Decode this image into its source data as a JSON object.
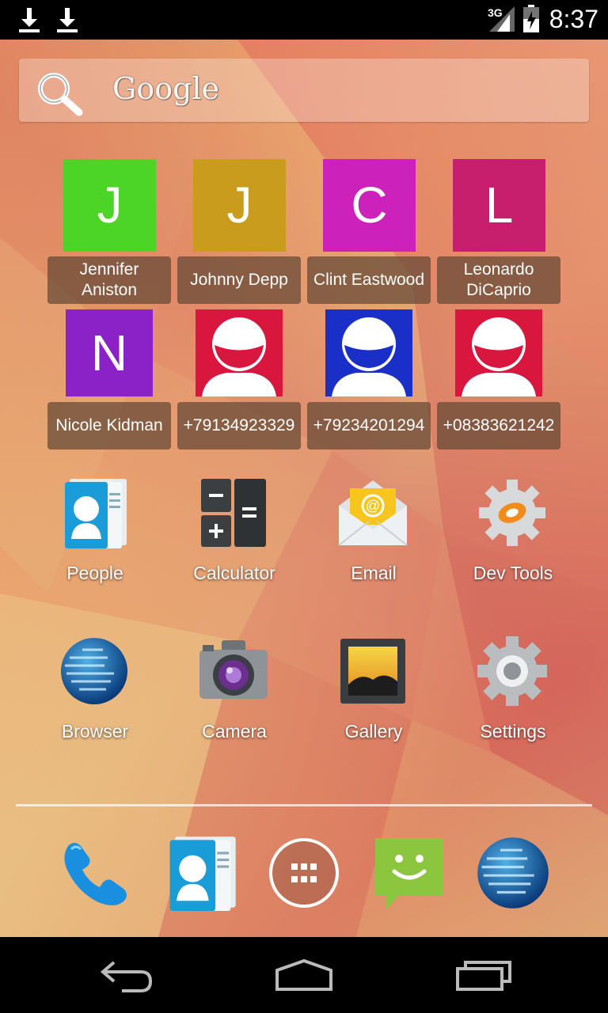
{
  "status_bar": {
    "time": "8:37",
    "network": "3G"
  },
  "search": {
    "label": "Google"
  },
  "contacts": [
    {
      "initial": "J",
      "name_line1": "Jennifer",
      "name_line2": "Aniston",
      "color": "#4cd426"
    },
    {
      "initial": "J",
      "name_line1": "Johnny Depp",
      "name_line2": "",
      "color": "#c99c1e"
    },
    {
      "initial": "C",
      "name_line1": "Clint Eastwood",
      "name_line2": "",
      "color": "#cc22bb"
    },
    {
      "initial": "L",
      "name_line1": "Leonardo",
      "name_line2": "DiCaprio",
      "color": "#c81e6e"
    },
    {
      "initial": "N",
      "name_line1": "Nicole Kidman",
      "name_line2": "",
      "color": "#8a22c8"
    },
    {
      "initial": "",
      "name_line1": "+79134923329",
      "name_line2": "",
      "color": "#d8163e"
    },
    {
      "initial": "",
      "name_line1": "+79234201294",
      "name_line2": "",
      "color": "#1a2ec8"
    },
    {
      "initial": "",
      "name_line1": "+08383621242",
      "name_line2": "",
      "color": "#d8163e"
    }
  ],
  "apps": [
    {
      "label": "People",
      "icon": "people-icon"
    },
    {
      "label": "Calculator",
      "icon": "calculator-icon"
    },
    {
      "label": "Email",
      "icon": "email-icon"
    },
    {
      "label": "Dev Tools",
      "icon": "dev-tools-icon"
    },
    {
      "label": "Browser",
      "icon": "browser-icon"
    },
    {
      "label": "Camera",
      "icon": "camera-icon"
    },
    {
      "label": "Gallery",
      "icon": "gallery-icon"
    },
    {
      "label": "Settings",
      "icon": "settings-icon"
    }
  ],
  "dock": [
    "phone-icon",
    "people-icon",
    "app-drawer-icon",
    "messaging-icon",
    "browser-icon"
  ],
  "nav": [
    "back-icon",
    "home-icon",
    "recents-icon"
  ]
}
